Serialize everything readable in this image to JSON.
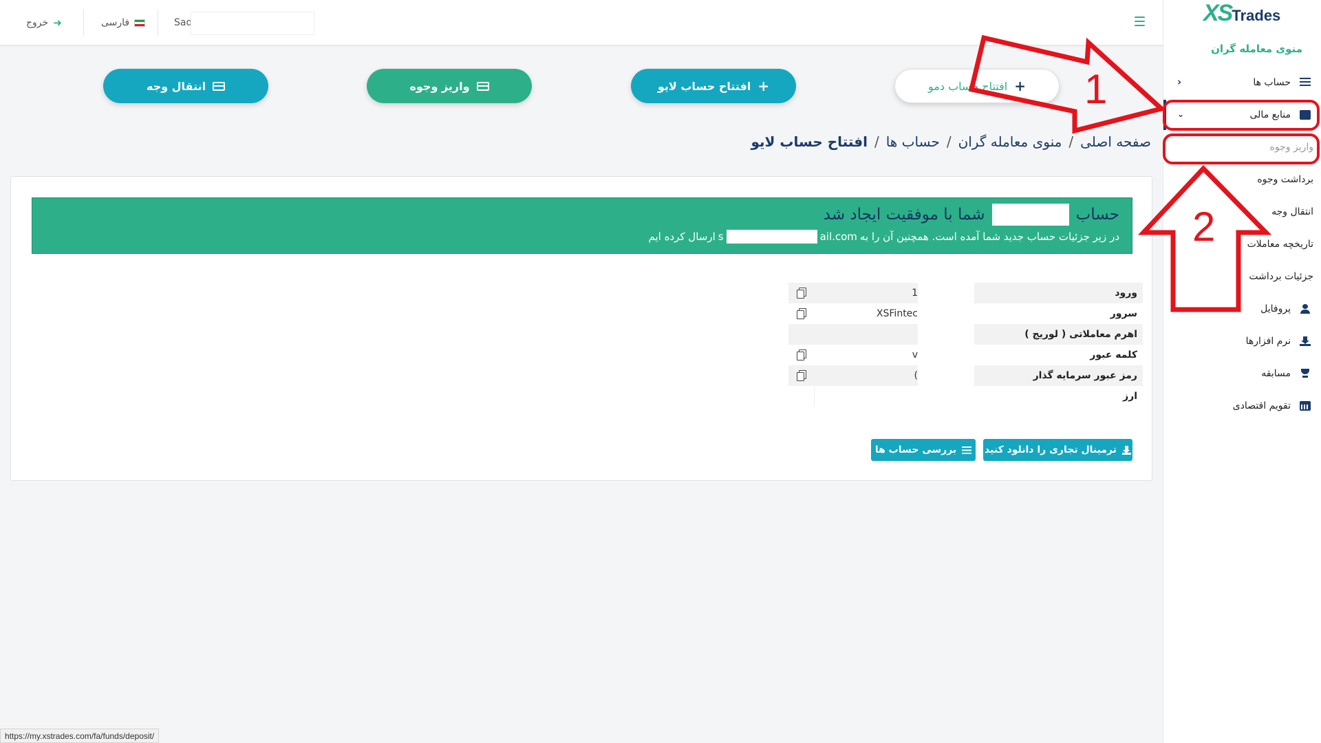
{
  "topbar": {
    "username": "Sad",
    "language": "فارسی",
    "logout": "خروج"
  },
  "actions": {
    "demo": "افتتاح حساب دمو",
    "live": "افتتاح حساب لایو",
    "deposit": "واریز وجوه",
    "transfer": "انتقال وجه"
  },
  "breadcrumb": {
    "home": "صفحه اصلی",
    "trader_menu": "منوی معامله گران",
    "accounts": "حساب ها",
    "current": "افتتاح حساب لایو",
    "separator": "/"
  },
  "alert": {
    "title_before": "حساب",
    "title_after": "شما با موفقیت ایجاد شد",
    "text_before": "در زیر جزئیات حساب جدید شما آمده است. همچنین آن را به",
    "email_prefix": "s",
    "email_suffix": "ail.com",
    "text_after": "ارسال کرده ایم"
  },
  "details": [
    {
      "label": "ورود",
      "value": "1"
    },
    {
      "label": "سرور",
      "value": "XSFintec"
    },
    {
      "label": "اهرم معاملاتی ( لوریج )",
      "value": ""
    },
    {
      "label": "کلمه عبور",
      "value": "v"
    },
    {
      "label": "رمز عبور سرمایه گذار",
      "value": "("
    },
    {
      "label": "ارز",
      "value": ""
    }
  ],
  "buttons": {
    "download_terminal": "ترمینال تجاری را دانلود کنید",
    "review_accounts": "بررسی حساب ها"
  },
  "sidebar": {
    "logo_xs": "XS",
    "logo_trades": "Trades",
    "title": "منوی معامله گران",
    "items": [
      {
        "label": "حساب ها",
        "icon": "list-icon"
      },
      {
        "label": "منابع مالی",
        "icon": "wallet-icon"
      },
      {
        "label": "واریز وجوه",
        "icon": ""
      },
      {
        "label": "برداشت وجوه",
        "icon": ""
      },
      {
        "label": "انتقال وجه",
        "icon": ""
      },
      {
        "label": "تاریخچه معاملات",
        "icon": ""
      },
      {
        "label": "جزئیات برداشت",
        "icon": ""
      },
      {
        "label": "پروفایل",
        "icon": "user-icon"
      },
      {
        "label": "نرم افزارها",
        "icon": "download-icon"
      },
      {
        "label": "مسابقه",
        "icon": "trophy-icon"
      },
      {
        "label": "تقویم اقتصادی",
        "icon": "calendar-icon"
      }
    ]
  },
  "status_url": "https://my.xstrades.com/fa/funds/deposit/",
  "annotations": {
    "step1": "1",
    "step2": "2",
    "color": "#e3141c"
  },
  "colors": {
    "green": "#2db08a",
    "teal": "#15a7bf",
    "navy": "#1a3a6a"
  }
}
